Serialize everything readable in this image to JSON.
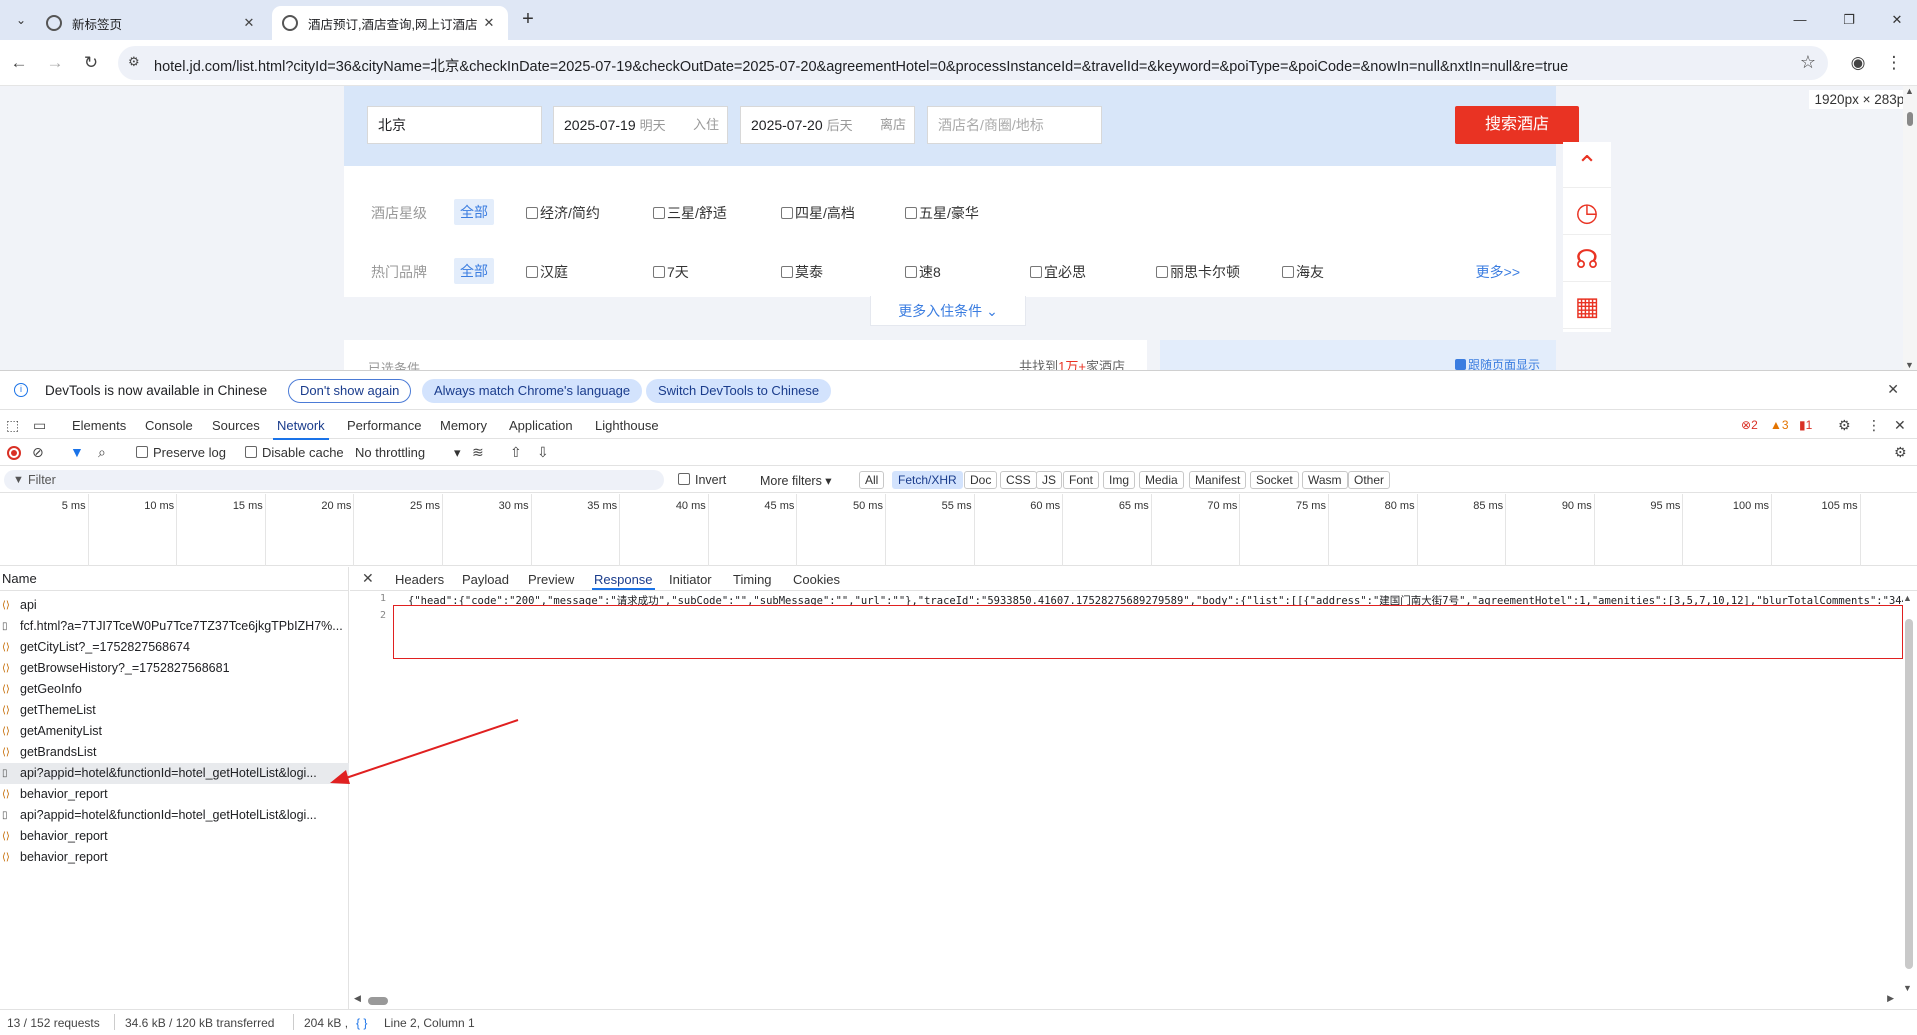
{
  "browser": {
    "tabs": [
      {
        "title": "新标签页"
      },
      {
        "title": "酒店预订,酒店查询,网上订酒店"
      }
    ],
    "url": "hotel.jd.com/list.html?cityId=36&cityName=北京&checkInDate=2025-07-19&checkOutDate=2025-07-20&agreementHotel=0&processInstanceId=&travelId=&keyword=&poiType=&poiCode=&nowIn=null&nxtIn=null&re=true"
  },
  "page": {
    "dims_badge": "1920px × 283px",
    "search": {
      "city": "北京",
      "checkin_date": "2025-07-19",
      "checkin_hint": "明天",
      "checkin_tag": "入住",
      "checkout_date": "2025-07-20",
      "checkout_hint": "后天",
      "checkout_tag": "离店",
      "keyword_placeholder": "酒店名/商圈/地标",
      "button": "搜索酒店"
    },
    "filters": {
      "star_label": "酒店星级",
      "all": "全部",
      "star_options": [
        "经济/简约",
        "三星/舒适",
        "四星/高档",
        "五星/豪华"
      ],
      "brand_label": "热门品牌",
      "brand_options": [
        "汉庭",
        "7天",
        "莫泰",
        "速8",
        "宜必思",
        "丽思卡尔顿",
        "海友"
      ],
      "more": "更多>>",
      "more_conditions": "更多入住条件"
    },
    "lower": {
      "selected_label": "已选条件",
      "count_prefix": "共找到",
      "count_value": "1万+",
      "count_suffix": "家酒店",
      "follow_page": "跟随页面显示"
    }
  },
  "devtools": {
    "infobar": {
      "message": "DevTools is now available in Chinese",
      "dont_show": "Don't show again",
      "always_match": "Always match Chrome's language",
      "switch": "Switch DevTools to Chinese"
    },
    "tabs": [
      "Elements",
      "Console",
      "Sources",
      "Network",
      "Performance",
      "Memory",
      "Application",
      "Lighthouse"
    ],
    "errors": "2",
    "warnings": "3",
    "issues": "1",
    "network_toolbar": {
      "preserve_log": "Preserve log",
      "disable_cache": "Disable cache",
      "throttling": "No throttling"
    },
    "filter": {
      "placeholder": "Filter",
      "invert": "Invert",
      "more_filters": "More filters",
      "chips": [
        "All",
        "Fetch/XHR",
        "Doc",
        "CSS",
        "JS",
        "Font",
        "Img",
        "Media",
        "Manifest",
        "Socket",
        "Wasm",
        "Other"
      ],
      "selected_chip": "Fetch/XHR"
    },
    "timeline_ticks": [
      "5 ms",
      "10 ms",
      "15 ms",
      "20 ms",
      "25 ms",
      "30 ms",
      "35 ms",
      "40 ms",
      "45 ms",
      "50 ms",
      "55 ms",
      "60 ms",
      "65 ms",
      "70 ms",
      "75 ms",
      "80 ms",
      "85 ms",
      "90 ms",
      "95 ms",
      "100 ms",
      "105 ms",
      "11"
    ],
    "requests_header": "Name",
    "requests": [
      {
        "name": "api",
        "type": "xhr"
      },
      {
        "name": "fcf.html?a=7TJI7TceW0Pu7Tce7TZ37Tce6jkgTPbIZH7%...",
        "type": "doc"
      },
      {
        "name": "getCityList?_=1752827568674",
        "type": "xhr"
      },
      {
        "name": "getBrowseHistory?_=1752827568681",
        "type": "xhr"
      },
      {
        "name": "getGeoInfo",
        "type": "xhr"
      },
      {
        "name": "getThemeList",
        "type": "xhr"
      },
      {
        "name": "getAmenityList",
        "type": "xhr"
      },
      {
        "name": "getBrandsList",
        "type": "xhr"
      },
      {
        "name": "api?appid=hotel&functionId=hotel_getHotelList&logi...",
        "type": "doc",
        "selected": true
      },
      {
        "name": "behavior_report",
        "type": "xhr"
      },
      {
        "name": "api?appid=hotel&functionId=hotel_getHotelList&logi...",
        "type": "doc"
      },
      {
        "name": "behavior_report",
        "type": "xhr"
      },
      {
        "name": "behavior_report",
        "type": "xhr"
      }
    ],
    "detail_tabs": [
      "Headers",
      "Payload",
      "Preview",
      "Response",
      "Initiator",
      "Timing",
      "Cookies"
    ],
    "active_detail_tab": "Response",
    "response_lines": [
      "{\"head\":{\"code\":\"200\",\"message\":\"请求成功\",\"subCode\":\"\",\"subMessage\":\"\",\"url\":\"\"},\"traceId\":\"5933850.41607.17528275689279589\",\"body\":{\"list\":[[{\"address\":\"建国门南大街7号\",\"agreementHotel\":1,\"amenities\":[3,5,7,10,12],\"blurTotalComments\":\"344\",\"brandN",
      ""
    ],
    "status": {
      "requests": "13 / 152 requests",
      "transferred": "34.6 kB / 120 kB transferred",
      "resources": "204 kB ,",
      "cursor": "Line 2, Column 1"
    }
  }
}
